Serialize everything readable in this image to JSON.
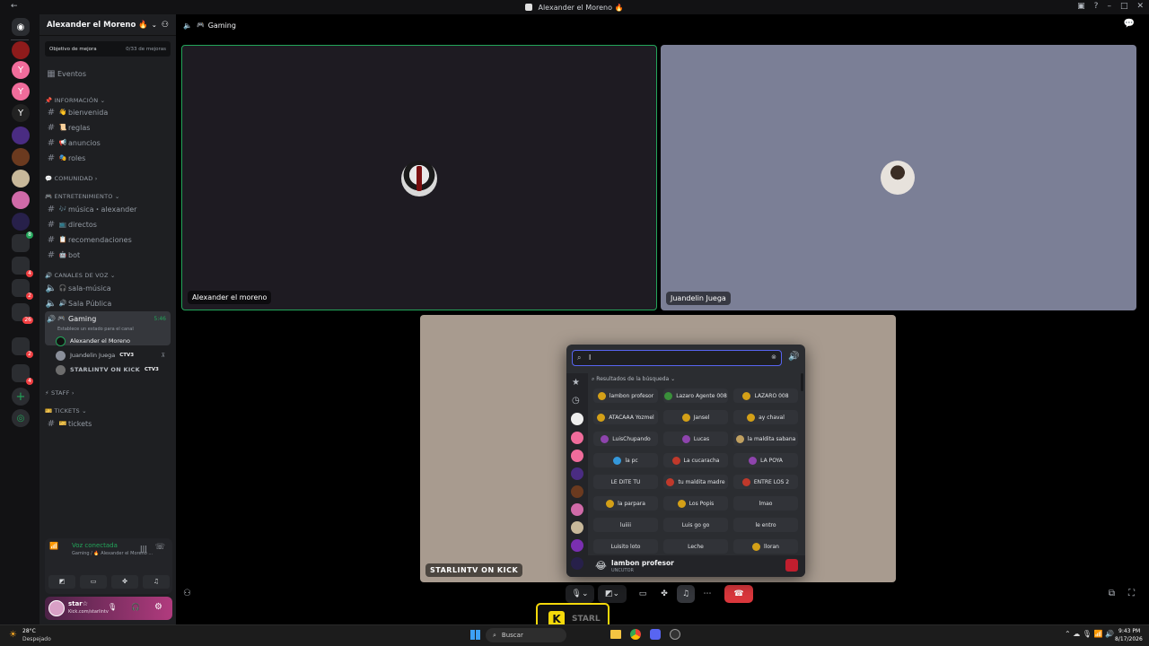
{
  "window": {
    "title": "Alexander el Moreno 🔥"
  },
  "server": {
    "name": "Alexander el Moreno 🔥",
    "boost_label": "Objetivo de mejora",
    "boost_count": "0/33 de mejoras",
    "events_label": "Eventos"
  },
  "categories": {
    "info": "📌 INFORMACIÓN",
    "community": "💬 COMUNIDAD",
    "entertainment": "🎮 ENTRETENIMIENTO",
    "voice": "🔊 CANALES DE VOZ",
    "staff": "⚡ STAFF",
    "tickets": "🎫 TICKETS"
  },
  "channels": {
    "bienvenida": "bienvenida",
    "reglas": "reglas",
    "anuncios": "anuncios",
    "roles": "roles",
    "musica": "música・alexander",
    "directos": "directos",
    "recomendaciones": "recomendaciones",
    "bot": "bot",
    "sala_musica": "sala-música",
    "sala_publica": "Sala Pública",
    "gaming": "Gaming",
    "gaming_time": "5:46",
    "gaming_status": "Establece un estado para el canal",
    "tickets": "tickets"
  },
  "voice_members": [
    {
      "name": "Alexander el Moreno",
      "tag": ""
    },
    {
      "name": "Juandelin Juega",
      "tag": "CTV3"
    },
    {
      "name": "STARLINTV ON KICK",
      "tag": "CTV3"
    }
  ],
  "voice_panel": {
    "status": "Voz conectada",
    "location": "Gaming / 🔥 Alexander el Moreno ..."
  },
  "user": {
    "name": "star☆",
    "status": "Kick.com/starlintv"
  },
  "header": {
    "channel": "Gaming"
  },
  "tiles": [
    {
      "name": "Alexander el moreno"
    },
    {
      "name": "Juandelin Juega"
    },
    {
      "name": "STARLINTV ON KICK"
    }
  ],
  "soundboard": {
    "search_value": "l",
    "results_label": "Resultados de la búsqueda",
    "sounds": [
      "lambon profesor",
      "Lazaro Agente 008",
      "LAZARO 008",
      "ATACAAA Yozmel",
      "Jansel",
      "ay chaval",
      "LuisChupando",
      "Lucas",
      "la maldita sabana",
      "la pc",
      "La cucaracha",
      "LA POYA",
      "LE DITE TU",
      "tu maldita madre",
      "ENTRE LOS 2",
      "la parpara",
      "Los Popis",
      "lmao",
      "luiiii",
      "Luis go go",
      "le entro",
      "Luisito loto",
      "Leche",
      "lloran"
    ],
    "footer_name": "lambon profesor",
    "footer_source": "UNCUTOR"
  },
  "taskbar": {
    "weather_temp": "28°C",
    "weather_desc": "Despejado",
    "search": "Buscar",
    "time": "9:43 PM",
    "date": "8/17/2026"
  },
  "overlay": {
    "letter": "K",
    "text": "STARL"
  },
  "colors": {
    "accent": "#5865f2",
    "green": "#23a55a",
    "red": "#da373c",
    "kick": "#53fc18"
  }
}
